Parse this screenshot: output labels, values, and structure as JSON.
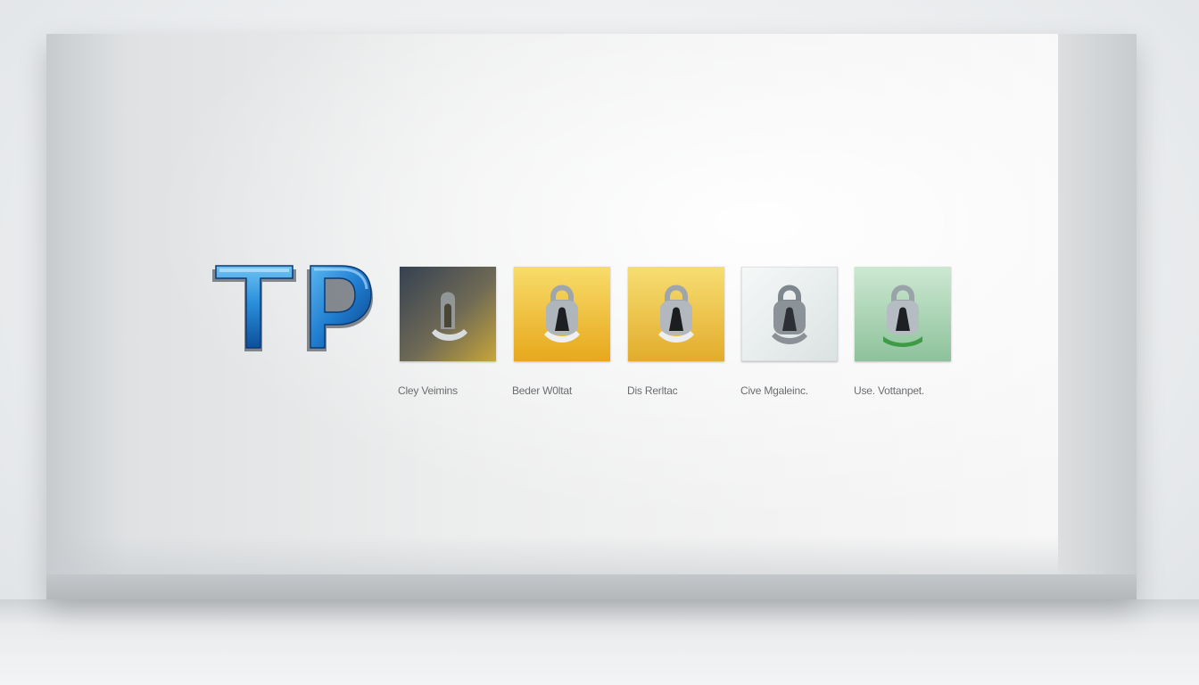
{
  "logo": {
    "text": "TP",
    "icon": "tp-logo-icon",
    "color": "#1c7fd0"
  },
  "tiles": [
    {
      "label": "Cley Veimins",
      "icon": "padlock-icon",
      "bg": [
        "#3e4a5a",
        "#c9a83a"
      ]
    },
    {
      "label": "Beder W0ltat",
      "icon": "padlock-icon",
      "bg": [
        "#f7d25a",
        "#e6a91f"
      ]
    },
    {
      "label": "Dis Rerltac",
      "icon": "padlock-icon",
      "bg": [
        "#f7dd6e",
        "#e3ad2a"
      ]
    },
    {
      "label": "Cive Mgaleinc.",
      "icon": "padlock-icon",
      "bg": [
        "#f4f6f6",
        "#dfe4e4"
      ]
    },
    {
      "label": "Use. Vottanpet.",
      "icon": "padlock-icon",
      "bg": [
        "#b9dcc2",
        "#8fc39c"
      ]
    }
  ]
}
